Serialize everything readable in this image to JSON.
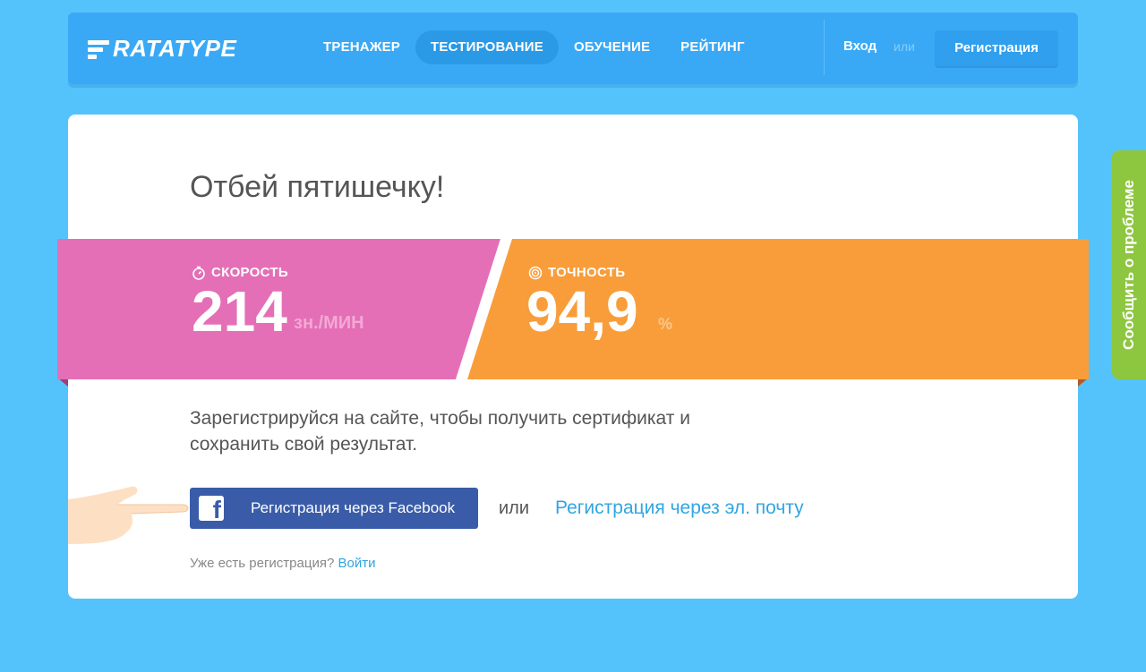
{
  "header": {
    "logo_text": "RATATYPE",
    "nav": [
      {
        "label": "ТРЕНАЖЕР"
      },
      {
        "label": "ТЕСТИРОВАНИЕ"
      },
      {
        "label": "ОБУЧЕНИЕ"
      },
      {
        "label": "РЕЙТИНГ"
      }
    ],
    "login_label": "Вход",
    "or_label": "или",
    "register_label": "Регистрация"
  },
  "card": {
    "title": "Отбей пятишечку!",
    "speed": {
      "label": "СКОРОСТЬ",
      "value": "214",
      "unit": "зн./МИН"
    },
    "accuracy": {
      "label": "ТОЧНОСТЬ",
      "value": "94,9",
      "unit": "%"
    },
    "register_text": "Зарегистрируйся на сайте, чтобы получить сертификат и сохранить свой результат.",
    "facebook_button": "Регистрация через Facebook",
    "or_label": "или",
    "email_link": "Регистрация через эл. почту",
    "already_text": "Уже есть регистрация?",
    "login_link": "Войти"
  },
  "feedback_tab": "Сообщить о проблеме",
  "colors": {
    "background": "#55c3fb",
    "header": "#3aa9f5",
    "speed_band": "#e46fb6",
    "accuracy_band": "#f99d3b",
    "facebook": "#3a5ca8",
    "link": "#31a5e3",
    "feedback": "#8dc63f"
  }
}
